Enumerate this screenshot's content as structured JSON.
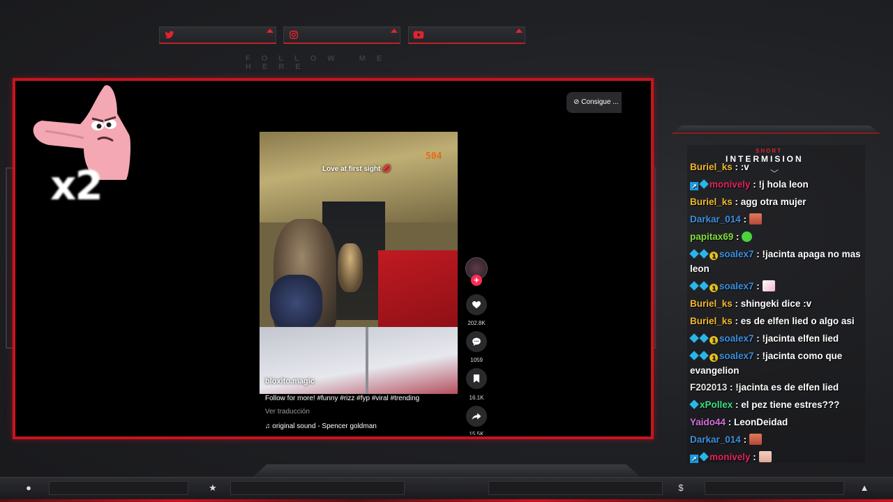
{
  "social": {
    "items": [
      {
        "name": "twitter",
        "icon": "twitter-icon",
        "glyph": "🐦"
      },
      {
        "name": "instagram",
        "icon": "instagram-icon",
        "glyph": "◎"
      },
      {
        "name": "youtube",
        "icon": "youtube-icon",
        "glyph": "▶"
      }
    ],
    "follow_text": "FOLLOW ME HERE"
  },
  "overlay": {
    "multiplier": "x2",
    "short_label": "SHORT",
    "intermission_label": "INTERMISION"
  },
  "video": {
    "consigue_label": "Consigue ...",
    "caption": "Love at first sight 💋",
    "sign_number": "504",
    "watermark": "bloxito.magic",
    "description": "Follow for more! #funny #rizz #fyp #viral #trending",
    "translate_link": "Ver traducción",
    "sound": "original sound - Spencer goldman",
    "likes": "202.8K",
    "comments": "1059",
    "saves": "16.1K",
    "shares": "15.5K"
  },
  "chat": {
    "messages": [
      {
        "badges": [],
        "user": "Buriel_ks",
        "color": "#f0b830",
        "text": ":v",
        "emote": null
      },
      {
        "badges": [
          "arrow",
          "gem"
        ],
        "user": "monively",
        "color": "#e0245e",
        "text": "!j hola leon",
        "emote": null
      },
      {
        "badges": [],
        "user": "Buriel_ks",
        "color": "#f0b830",
        "text": "agg otra mujer",
        "emote": null
      },
      {
        "badges": [],
        "user": "Darkar_014",
        "color": "#3c8fe0",
        "text": "",
        "emote": "face"
      },
      {
        "badges": [],
        "user": "papitax69",
        "color": "#7fe03c",
        "text": "",
        "emote": "blob"
      },
      {
        "badges": [
          "gem",
          "gem",
          "coin"
        ],
        "user": "soalex7",
        "color": "#3c8fe0",
        "text": "!jacinta apaga no mas leon",
        "emote": null
      },
      {
        "badges": [
          "gem",
          "gem",
          "coin"
        ],
        "user": "soalex7",
        "color": "#3c8fe0",
        "text": "",
        "emote": "unicorn"
      },
      {
        "badges": [],
        "user": "Buriel_ks",
        "color": "#f0b830",
        "text": "shingeki dice :v",
        "emote": null
      },
      {
        "badges": [],
        "user": "Buriel_ks",
        "color": "#f0b830",
        "text": "es de elfen lied o algo asi",
        "emote": null
      },
      {
        "badges": [
          "gem",
          "gem",
          "coin"
        ],
        "user": "soalex7",
        "color": "#3c8fe0",
        "text": "!jacinta elfen lied",
        "emote": null
      },
      {
        "badges": [
          "gem",
          "gem",
          "coin"
        ],
        "user": "soalex7",
        "color": "#3c8fe0",
        "text": "!jacinta como que evangelion",
        "emote": null
      },
      {
        "badges": [],
        "user": "F202013",
        "color": "#e8e8e8",
        "text": "!jacinta es de elfen lied",
        "emote": null
      },
      {
        "badges": [
          "gem"
        ],
        "user": "xPollex",
        "color": "#3ce07f",
        "text": "el pez tiene estres???",
        "emote": null
      },
      {
        "badges": [],
        "user": "Yaido44",
        "color": "#d470e0",
        "text": "LeonDeidad",
        "emote": null
      },
      {
        "badges": [],
        "user": "Darkar_014",
        "color": "#3c8fe0",
        "text": "",
        "emote": "face"
      },
      {
        "badges": [
          "arrow",
          "gem"
        ],
        "user": "monively",
        "color": "#e0245e",
        "text": "",
        "emote": "hand"
      }
    ]
  },
  "bottom": {
    "icons": [
      {
        "name": "user-icon",
        "glyph": "●"
      },
      {
        "name": "star-icon",
        "glyph": "★"
      },
      {
        "name": "dollar-icon",
        "glyph": "$"
      },
      {
        "name": "rocket-icon",
        "glyph": "▲"
      }
    ]
  },
  "colors": {
    "accent_red": "#c8141f",
    "background": "#1e1f22",
    "tiktok_pink": "#fe2c55"
  }
}
